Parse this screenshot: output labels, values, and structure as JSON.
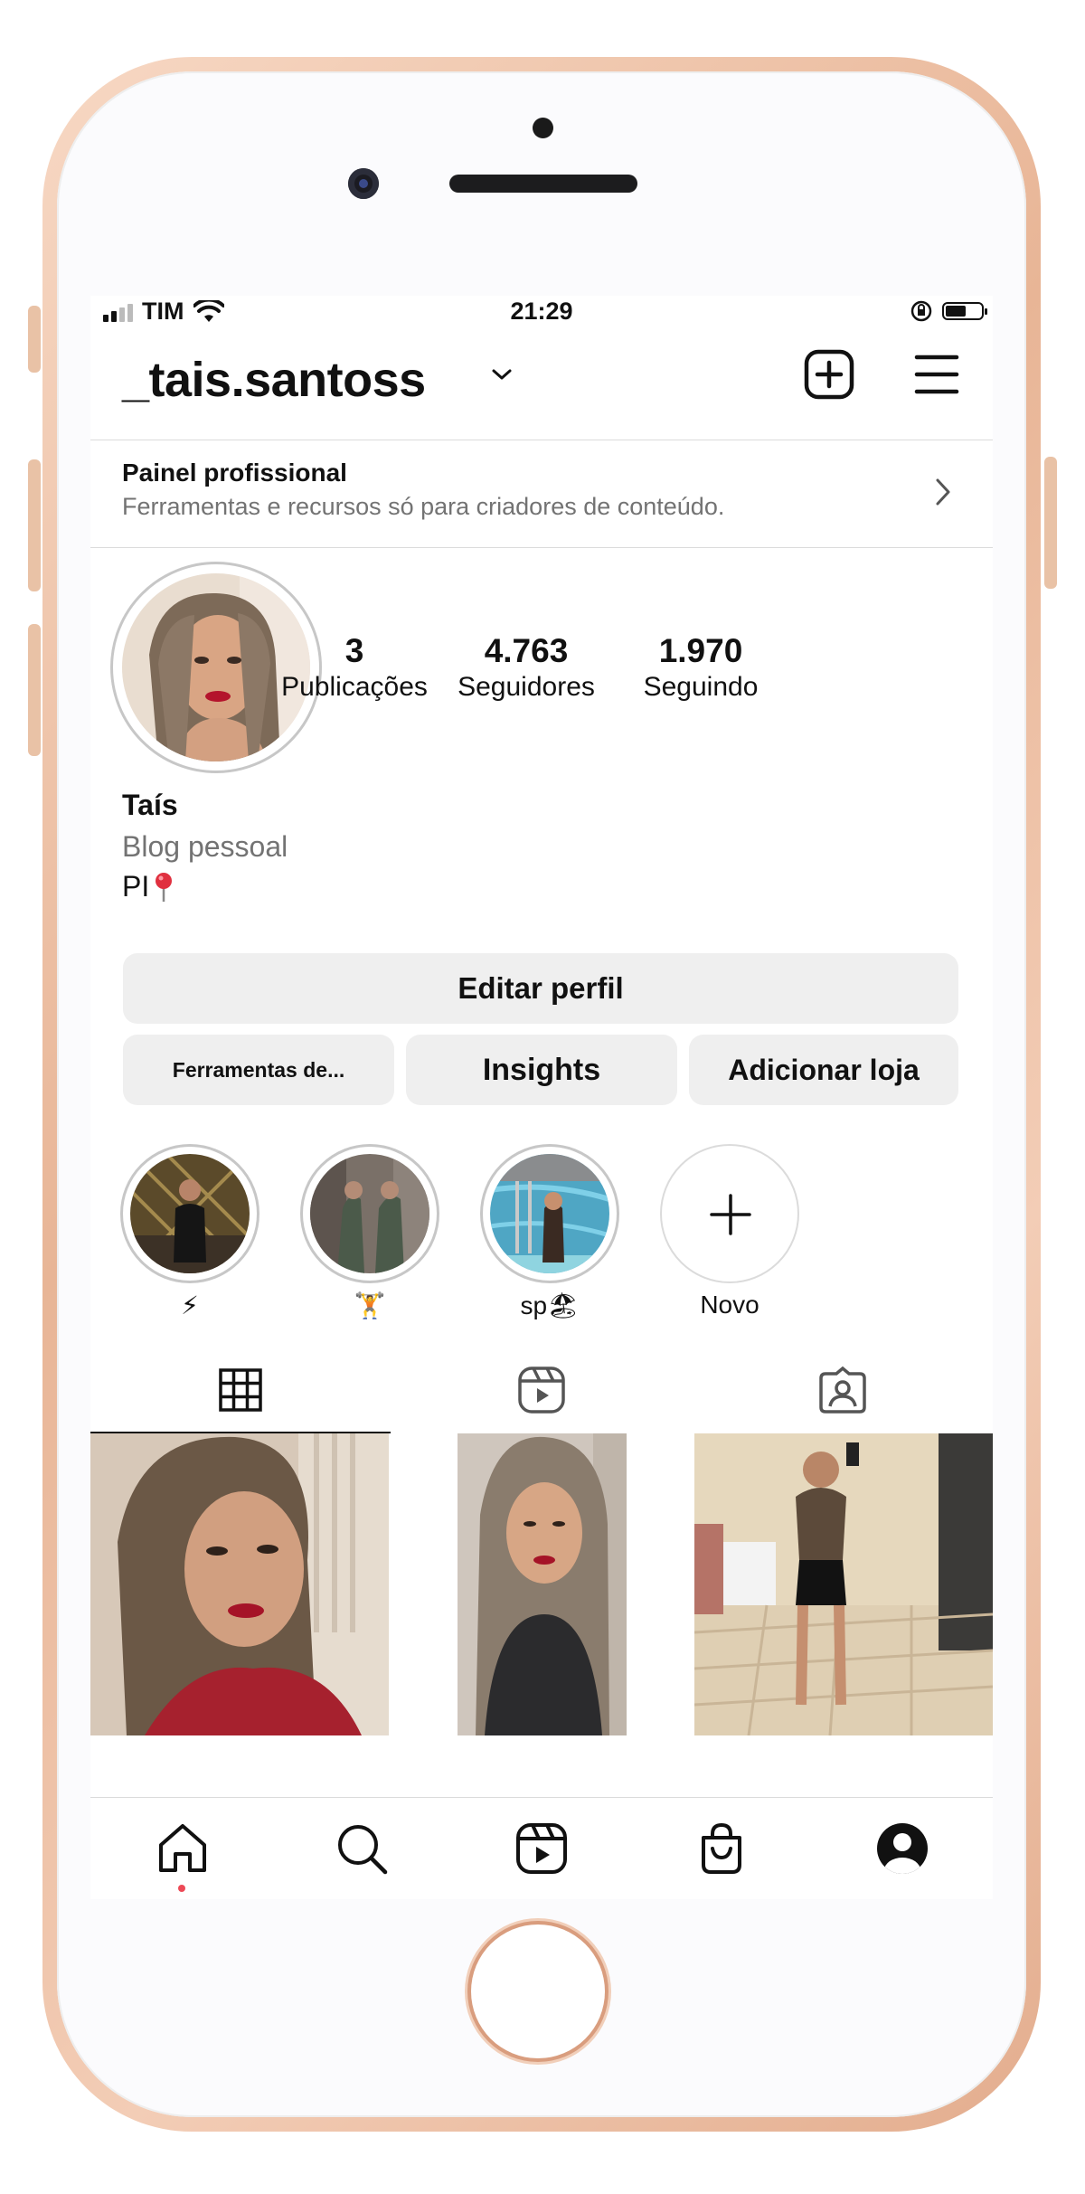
{
  "status_bar": {
    "carrier": "TIM",
    "time": "21:29"
  },
  "profile": {
    "username": "_tais.santoss",
    "stats": [
      {
        "count": "3",
        "label": "Publicações"
      },
      {
        "count": "4.763",
        "label": "Seguidores"
      },
      {
        "count": "1.970",
        "label": "Seguindo"
      }
    ],
    "name": "Taís",
    "category": "Blog pessoal",
    "location": "PI"
  },
  "professional_panel": {
    "title": "Painel profissional",
    "subtitle": "Ferramentas e recursos só para criadores de conteúdo."
  },
  "buttons": {
    "edit_profile": "Editar perfil",
    "tools": "Ferramentas de...",
    "insights": "Insights",
    "add_shop": "Adicionar loja"
  },
  "highlights": [
    {
      "label": "⚡"
    },
    {
      "label": "🏋"
    },
    {
      "label": "sp🏖"
    },
    {
      "label": "Novo"
    }
  ],
  "tabs": [
    "grid-icon",
    "reels-icon",
    "tagged-icon"
  ],
  "bottom_nav": [
    "home-icon",
    "search-icon",
    "reels-icon",
    "shop-icon",
    "profile-icon"
  ],
  "colors": {
    "accent_dot": "#ed4956",
    "button_bg": "#efefef",
    "secondary_text": "#737373",
    "phone_frame": "#e8b596"
  }
}
